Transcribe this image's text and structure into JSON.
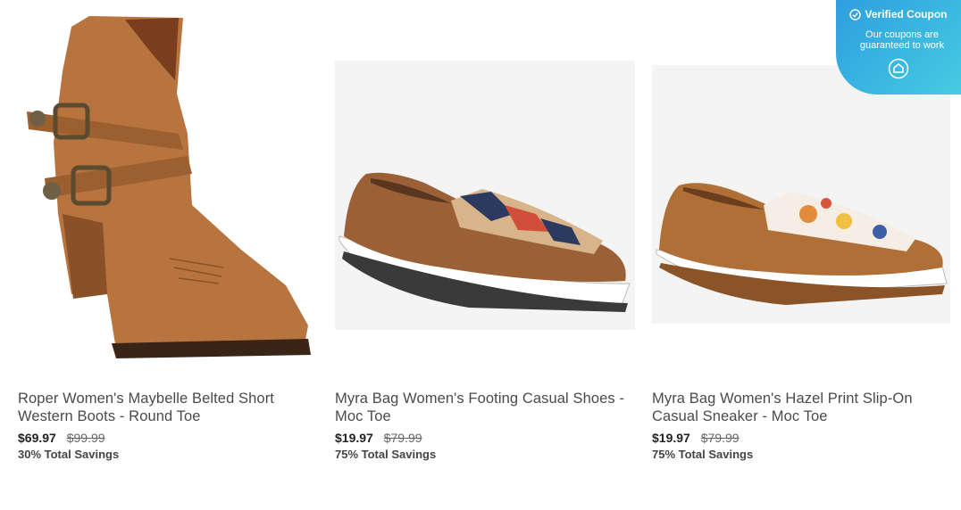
{
  "products": [
    {
      "title": "Roper Women's Maybelle Belted Short Western Boots - Round Toe",
      "price": "$69.97",
      "original_price": "$99.99",
      "savings": "30% Total Savings"
    },
    {
      "title": "Myra Bag Women's Footing Casual Shoes - Moc Toe",
      "price": "$19.97",
      "original_price": "$79.99",
      "savings": "75% Total Savings"
    },
    {
      "title": "Myra Bag Women's Hazel Print Slip-On Casual Sneaker - Moc Toe",
      "price": "$19.97",
      "original_price": "$79.99",
      "savings": "75% Total Savings"
    }
  ],
  "coupon": {
    "title": "Verified Coupon",
    "subtitle": "Our coupons are guaranteed to work",
    "check_icon": "check-circle-icon",
    "badge_icon": "shield-badge-icon",
    "colors": {
      "start": "#2e9ee0",
      "end": "#45cce2"
    }
  }
}
